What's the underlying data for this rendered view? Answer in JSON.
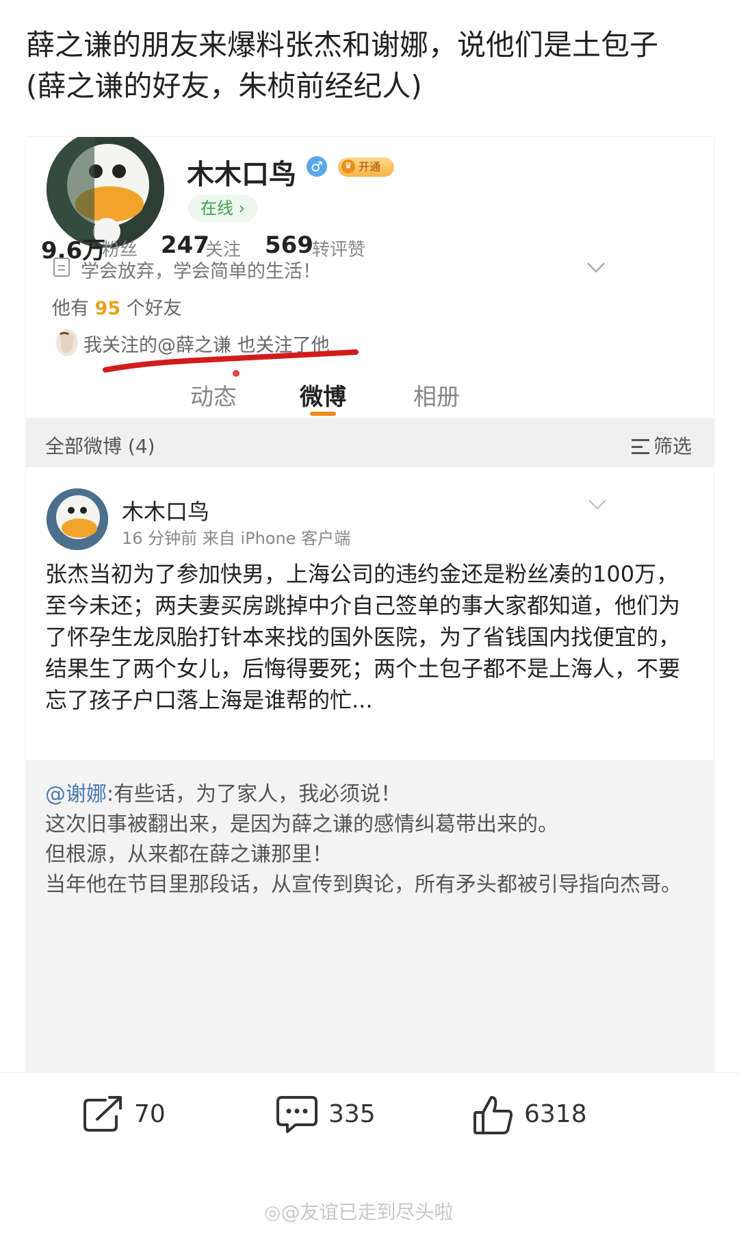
{
  "caption": {
    "line1": "薛之谦的朋友来爆料张杰和谢娜，说他们是土包子",
    "line2": "(薛之谦的好友，朱桢前经纪人)"
  },
  "profile": {
    "username": "木木口鸟",
    "gender_symbol": "♂",
    "vip_label": "开通",
    "online_label": "在线 ›",
    "stats": [
      {
        "value": "9.6万",
        "label": "粉丝"
      },
      {
        "value": "247",
        "label": "关注"
      },
      {
        "value": "569",
        "label": "转评赞"
      }
    ],
    "bio": "学会放弃，学会简单的生活！",
    "friends_prefix": "他有 ",
    "friends_count": "95",
    "friends_suffix": " 个好友",
    "mutual_follow": "我关注的@薛之谦 也关注了他"
  },
  "tabs": [
    {
      "label": "动态",
      "active": false
    },
    {
      "label": "微博",
      "active": true
    },
    {
      "label": "相册",
      "active": false
    }
  ],
  "filter_bar": {
    "left": "全部微博 (4)",
    "right": "筛选"
  },
  "post": {
    "author": "木木口鸟",
    "meta": "16 分钟前  来自 iPhone 客户端",
    "body": "张杰当初为了参加快男，上海公司的违约金还是粉丝凑的100万，至今未还；两夫妻买房跳掉中介自己签单的事大家都知道，他们为了怀孕生龙凤胎打针本来找的国外医院，为了省钱国内找便宜的，结果生了两个女儿，后悔得要死；两个土包子都不是上海人，不要忘了孩子户口落上海是谁帮的忙..."
  },
  "quoted": {
    "mention": "@谢娜",
    "line1": ":有些话，为了家人，我必须说！",
    "line2": "这次旧事被翻出来，是因为薛之谦的感情纠葛带出来的。",
    "line3": "但根源，从来都在薛之谦那里！",
    "line4": "当年他在节目里那段话，从宣传到舆论，所有矛头都被引导指向杰哥。"
  },
  "actions": {
    "repost_count": "70",
    "comment_count": "335",
    "like_count": "6318"
  },
  "watermark": "@友谊已走到尽头啦",
  "colors": {
    "accent_orange": "#f18a1c",
    "online_green": "#3fa04e",
    "mention_blue": "#4a7bb0",
    "highlight_red": "#d21c1c"
  }
}
